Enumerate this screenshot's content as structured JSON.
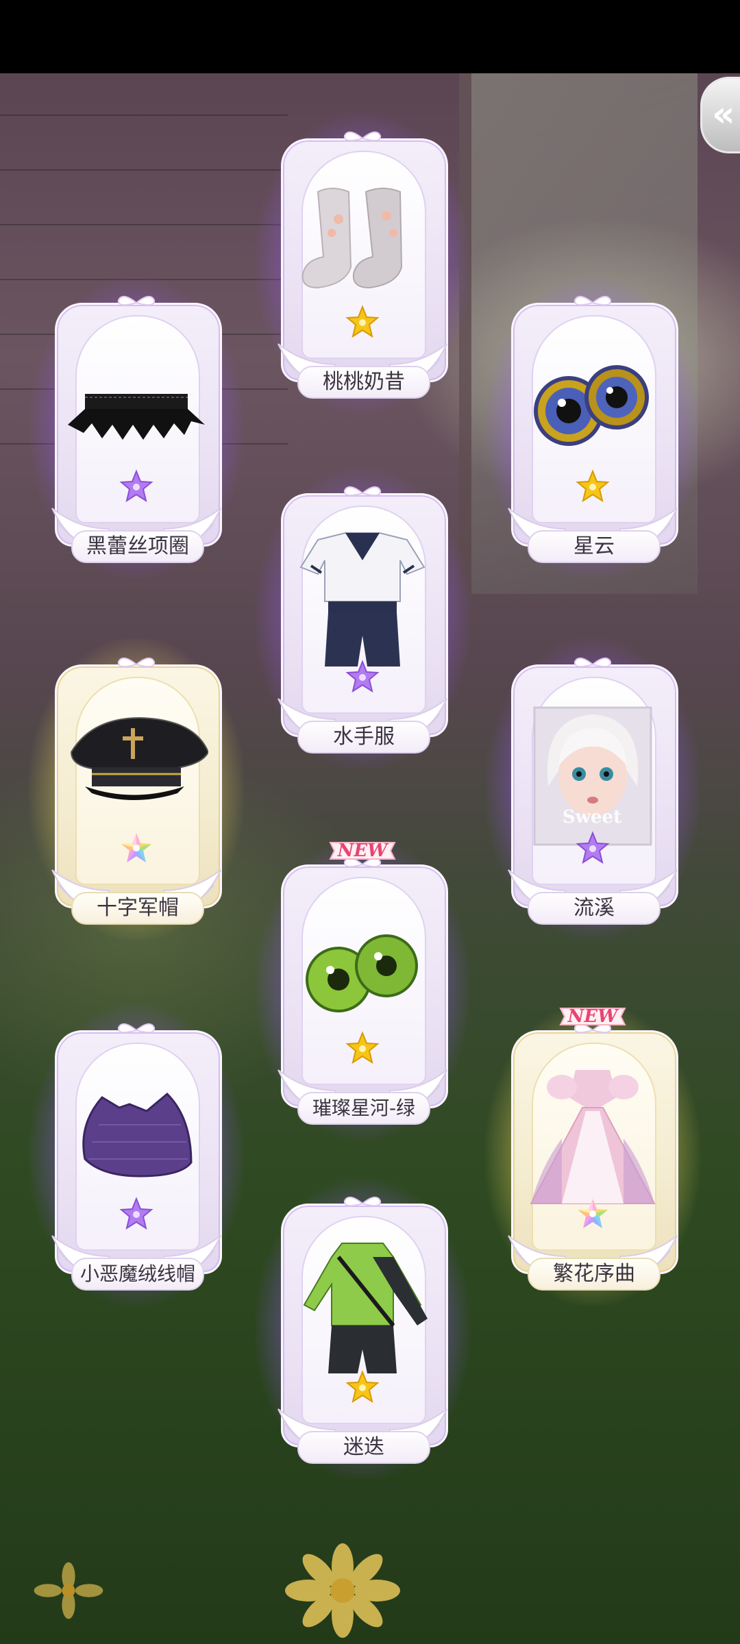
{
  "nav": {
    "back_icon": "double-chevron-left-icon"
  },
  "badges": {
    "new": "NEW"
  },
  "colors": {
    "purple_aura": "#a070ff",
    "gold_aura": "#ffe88c",
    "gold_star": "#f5c518",
    "purple_star": "#b27cf0"
  },
  "items": [
    {
      "name": "桃桃奶昔",
      "rarity_icon": "gold-star-icon",
      "type": "socks",
      "new": false
    },
    {
      "name": "黑蕾丝项圈",
      "rarity_icon": "purple-star-icon",
      "type": "lace-choker",
      "new": false
    },
    {
      "name": "星云",
      "rarity_icon": "gold-star-icon",
      "type": "eyes",
      "new": false
    },
    {
      "name": "水手服",
      "rarity_icon": "purple-star-icon",
      "type": "sailor-outfit",
      "new": false
    },
    {
      "name": "十字军帽",
      "rarity_icon": "rainbow-star-icon",
      "type": "military-cap",
      "new": false
    },
    {
      "name": "流溪",
      "rarity_icon": "purple-star-icon",
      "type": "doll-face-makeup",
      "portrait_caption": "Sweet",
      "new": false
    },
    {
      "name": "璀璨星河-绿",
      "rarity_icon": "gold-star-icon",
      "type": "green-eyes",
      "new": true
    },
    {
      "name": "小恶魔绒线帽",
      "rarity_icon": "purple-star-icon",
      "type": "knit-hat",
      "new": false
    },
    {
      "name": "繁花序曲",
      "rarity_icon": "rainbow-star-icon",
      "type": "floral-gown",
      "new": true
    },
    {
      "name": "迷迭",
      "rarity_icon": "gold-star-icon",
      "type": "green-outfit",
      "new": false
    }
  ]
}
